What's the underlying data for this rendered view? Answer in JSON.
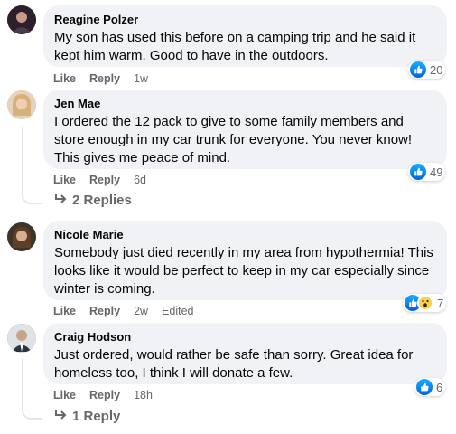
{
  "comments": [
    {
      "author": "Reagine Polzer",
      "text": "My son has used this before on a camping trip and he said it\nkept him warm. Good to have in the outdoors.",
      "like_label": "Like",
      "reply_label": "Reply",
      "time": "1w",
      "reaction_count": "20",
      "avatar_color": "#3a2b3a"
    },
    {
      "author": "Jen Mae",
      "text": "I ordered the 12 pack to give to some family members and\nstore enough in my car trunk for everyone. You never know!\nThis gives me peace of mind.",
      "like_label": "Like",
      "reply_label": "Reply",
      "time": "6d",
      "reaction_count": "49",
      "replies_label": "2 Replies",
      "avatar_color": "#c9a27c"
    },
    {
      "author": "Nicole Marie",
      "text": "Somebody just died recently in my area from hypothermia! This\nlooks like it would be perfect to keep in my car especially since\nwinter is coming.",
      "like_label": "Like",
      "reply_label": "Reply",
      "time": "2w",
      "edited_label": "Edited",
      "reaction_count": "7",
      "avatar_color": "#5a4a3a"
    },
    {
      "author": "Craig Hodson",
      "text": "Just ordered, would rather be safe than sorry. Great idea for\nhomeless too, I think I will donate a few.",
      "like_label": "Like",
      "reply_label": "Reply",
      "time": "18h",
      "reaction_count": "6",
      "replies_label": "1 Reply",
      "avatar_color": "#8a8f96"
    }
  ],
  "colors": {
    "bubble": "#f0f2f5",
    "meta_text": "#65676b",
    "like_blue": "#1877f2"
  }
}
